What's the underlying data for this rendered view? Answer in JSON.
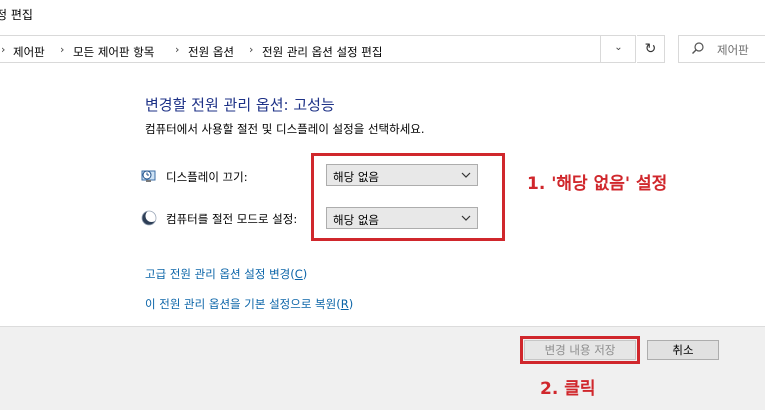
{
  "window": {
    "title": "정 편집"
  },
  "address": {
    "crumbs": [
      "제어판",
      "모든 제어판 항목",
      "전원 옵션",
      "전원 관리 옵션 설정 편집"
    ],
    "search_placeholder": "제어판 "
  },
  "main": {
    "heading": "변경할 전원 관리 옵션: 고성능",
    "subheading": "컴퓨터에서 사용할 절전 및 디스플레이 설정을 선택하세요.",
    "rows": [
      {
        "label": "디스플레이 끄기:",
        "value": "해당 없음",
        "icon": "monitor-clock-icon"
      },
      {
        "label": "컴퓨터를 절전 모드로 설정:",
        "value": "해당 없음",
        "icon": "moon-icon"
      }
    ],
    "links": [
      {
        "text": "고급 전원 관리 옵션 설정 변경(",
        "accel": "C",
        "close": ")"
      },
      {
        "text": "이 전원 관리 옵션을 기본 설정으로 복원(",
        "accel": "R",
        "close": ")"
      }
    ]
  },
  "annotations": {
    "step1": "1. '해당 없음' 설정",
    "step2": "2. 클릭"
  },
  "footer": {
    "save_label": "변경 내용 저장",
    "cancel_label": "취소"
  },
  "colors": {
    "accent_red": "#d0272c",
    "heading_blue": "#1e3287",
    "link_blue": "#0a64a8"
  }
}
